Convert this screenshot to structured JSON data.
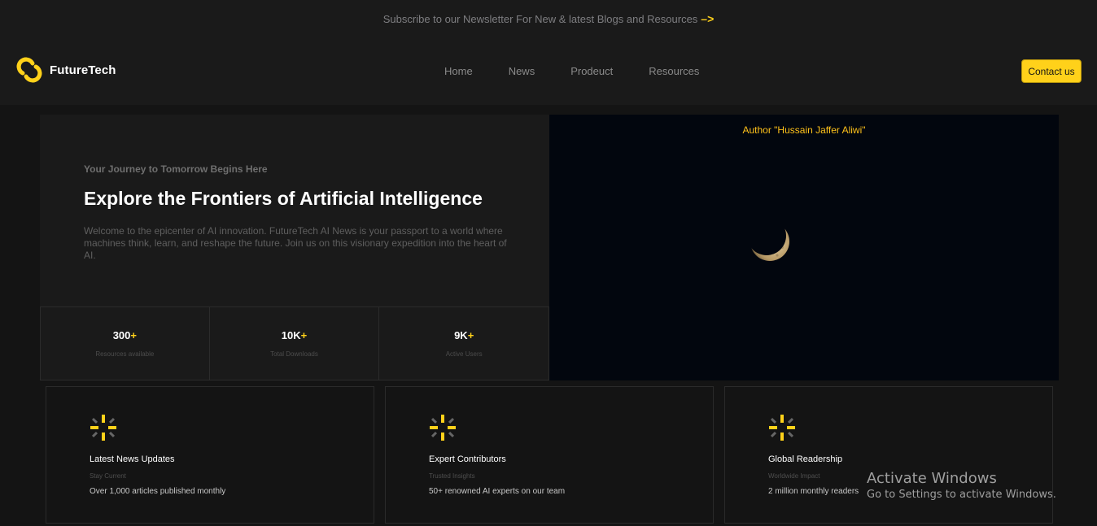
{
  "banner": {
    "text": "Subscribe to our Newsletter For New & latest Blogs and Resources",
    "arrow": "–>"
  },
  "brand": {
    "name": "FutureTech",
    "accent": "#ffd11a"
  },
  "nav": {
    "links": [
      "Home",
      "News",
      "Prodeuct",
      "Resources"
    ],
    "contact_label": "Contact us"
  },
  "hero": {
    "eyebrow": "Your Journey to Tomorrow Begins Here",
    "title": "Explore the Frontiers of Artificial Intelligence",
    "description": "Welcome to the epicenter of AI innovation. FutureTech AI News is your passport to a world where machines think, learn, and reshape the future. Join us on this visionary expedition into the heart of AI.",
    "stats": [
      {
        "value": "300",
        "plus": "+",
        "label": "Resources available"
      },
      {
        "value": "10K",
        "plus": "+",
        "label": "Total Downloads"
      },
      {
        "value": "9K",
        "plus": "+",
        "label": "Active Users"
      }
    ],
    "image_caption": "Author \"Hussain Jaffer Aliwi\""
  },
  "features": [
    {
      "icon": "sparkle-icon",
      "title": "Latest News Updates",
      "subtitle": "Stay Current",
      "description": "Over 1,000 articles published monthly"
    },
    {
      "icon": "sparkle-icon",
      "title": "Expert Contributors",
      "subtitle": "Trusted Insights",
      "description": "50+ renowned AI experts on our team"
    },
    {
      "icon": "sparkle-icon",
      "title": "Global Readership",
      "subtitle": "Worldwide Impact",
      "description": "2 million monthly readers"
    }
  ],
  "os_overlay": {
    "title": "Activate Windows",
    "subtitle": "Go to Settings to activate Windows."
  }
}
